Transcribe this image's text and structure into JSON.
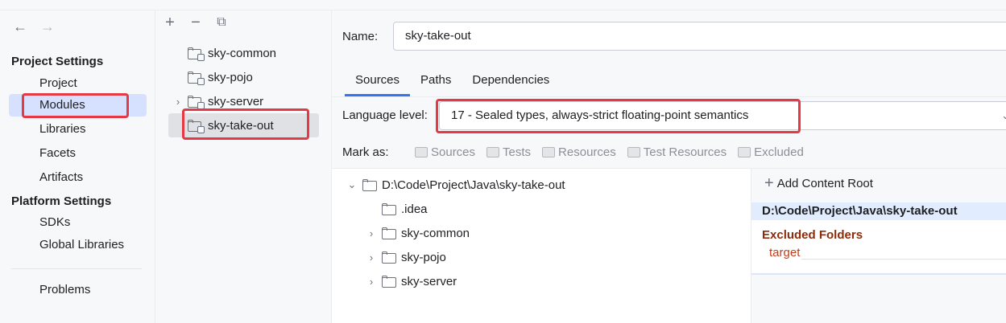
{
  "sidebar": {
    "nav": {
      "back": "←",
      "forward": "→"
    },
    "project_settings_title": "Project Settings",
    "project_items": [
      {
        "label": "Project"
      },
      {
        "label": "Modules"
      },
      {
        "label": "Libraries"
      },
      {
        "label": "Facets"
      },
      {
        "label": "Artifacts"
      }
    ],
    "platform_settings_title": "Platform Settings",
    "platform_items": [
      {
        "label": "SDKs"
      },
      {
        "label": "Global Libraries"
      }
    ],
    "problems_label": "Problems"
  },
  "modules_panel": {
    "toolbar": {
      "add": "+",
      "remove": "−",
      "copy": "⧉"
    },
    "items": [
      {
        "label": "sky-common"
      },
      {
        "label": "sky-pojo"
      },
      {
        "label": "sky-server"
      },
      {
        "label": "sky-take-out"
      }
    ]
  },
  "module": {
    "name_label": "Name:",
    "name_value": "sky-take-out",
    "tabs": [
      {
        "label": "Sources"
      },
      {
        "label": "Paths"
      },
      {
        "label": "Dependencies"
      }
    ],
    "language_level_label": "Language level:",
    "language_level_value": "17 - Sealed types, always-strict floating-point semantics",
    "mark_as_label": "Mark as:",
    "mark_as_buttons": [
      {
        "label": "Sources"
      },
      {
        "label": "Tests"
      },
      {
        "label": "Resources"
      },
      {
        "label": "Test Resources"
      },
      {
        "label": "Excluded"
      }
    ]
  },
  "tree": {
    "root": "D:\\Code\\Project\\Java\\sky-take-out",
    "children": [
      {
        "label": ".idea"
      },
      {
        "label": "sky-common"
      },
      {
        "label": "sky-pojo"
      },
      {
        "label": "sky-server"
      }
    ]
  },
  "content_roots": {
    "add_label": "Add Content Root",
    "root_path": "D:\\Code\\Project\\Java\\sky-take-out",
    "excluded_title": "Excluded Folders",
    "excluded_items": [
      {
        "label": "target"
      }
    ]
  },
  "colors": {
    "accent": "#3574f0",
    "highlight": "#e53946",
    "excluded_title": "#8a2c0b",
    "excluded_item": "#c33e1d"
  }
}
